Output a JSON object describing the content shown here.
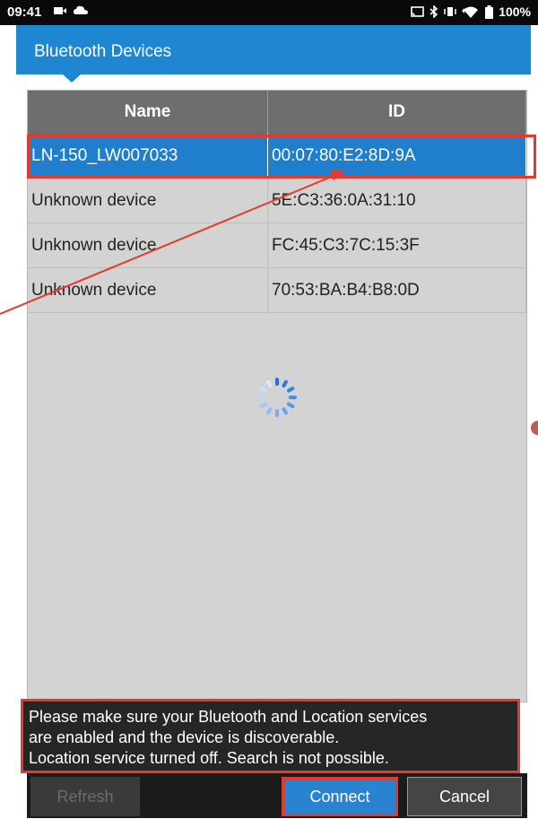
{
  "status_bar": {
    "time": "09:41",
    "left_icons": [
      "camera-icon",
      "cloud-icon"
    ],
    "right_icons": [
      "cast-icon",
      "bluetooth-icon",
      "vibrate-icon",
      "wifi-icon",
      "battery-icon"
    ],
    "battery": "100%"
  },
  "header": {
    "title": "Bluetooth Devices"
  },
  "table": {
    "columns": [
      "Name",
      "ID"
    ],
    "rows": [
      {
        "name": "LN-150_LW007033",
        "id": "00:07:80:E2:8D:9A",
        "selected": true
      },
      {
        "name": "Unknown device",
        "id": "5E:C3:36:0A:31:10",
        "selected": false
      },
      {
        "name": "Unknown device",
        "id": "FC:45:C3:7C:15:3F",
        "selected": false
      },
      {
        "name": "Unknown device",
        "id": "70:53:BA:B4:B8:0D",
        "selected": false
      }
    ]
  },
  "message": {
    "line1": "Please make sure your Bluetooth and Location services",
    "line2": "are enabled and the device is discoverable.",
    "line3": "Location service turned off. Search is not possible."
  },
  "buttons": {
    "refresh": "Refresh",
    "connect": "Connect",
    "cancel": "Cancel"
  },
  "colors": {
    "accent": "#1f86d1",
    "selected_row": "#1f7fcc",
    "highlight": "#e53a2a",
    "panel": "#d3d3d3"
  },
  "loading_indicator": "spinner-icon"
}
